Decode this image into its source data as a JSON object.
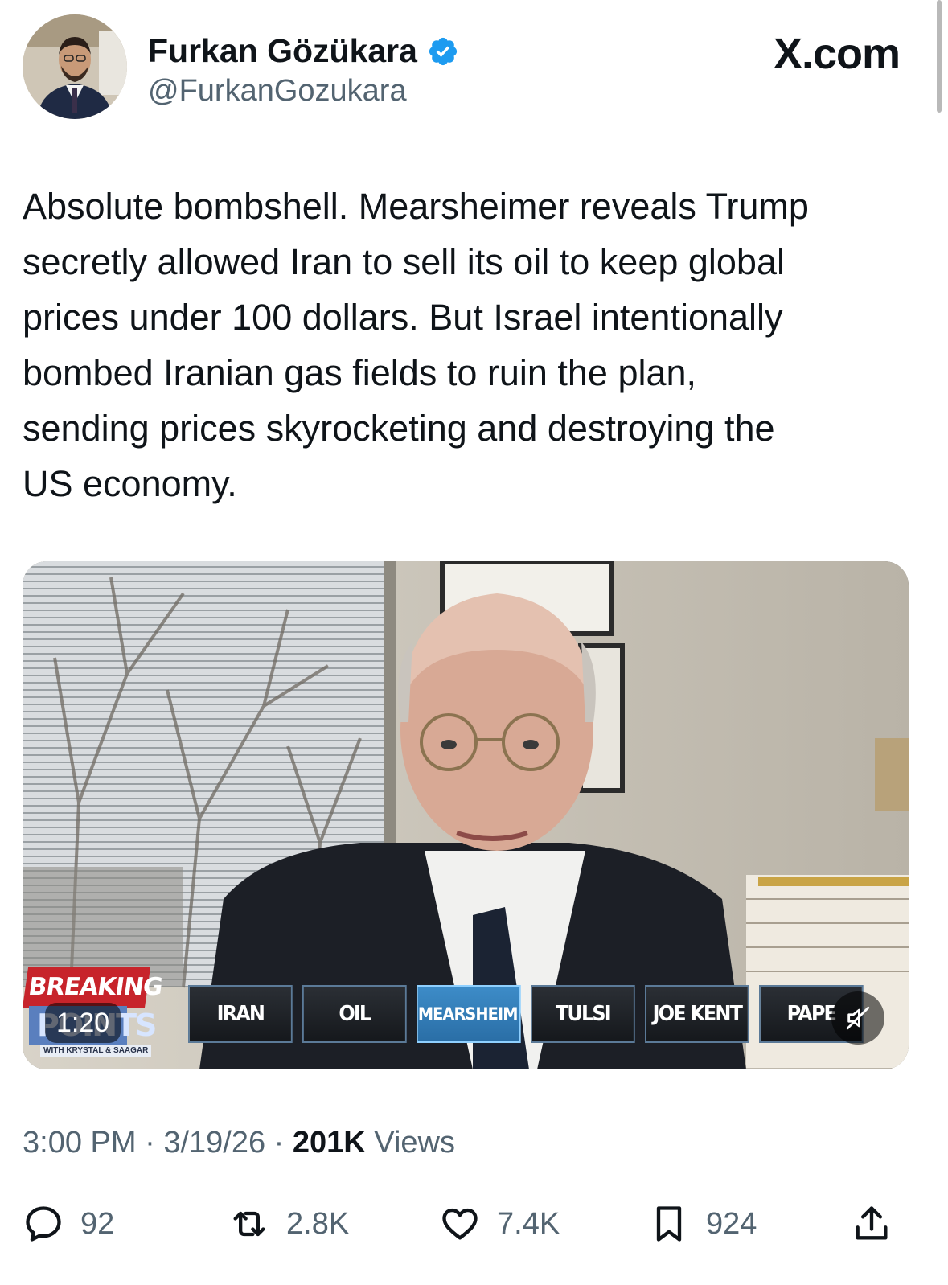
{
  "author": {
    "name": "Furkan Gözükara",
    "handle": "@FurkanGozukara",
    "verified": true,
    "avatar_icon": "profile-photo"
  },
  "site_logo": "X.com",
  "tweet": {
    "text": "Absolute bombshell. Mearsheimer reveals Trump\nsecretly allowed Iran to sell its oil to keep global\nprices under 100 dollars. But Israel intentionally\nbombed Iranian gas fields to ruin the plan,\nsending prices skyrocketing and destroying the\nUS economy."
  },
  "video": {
    "duration": "1:20",
    "breaking_label": "BREAKING",
    "show_logo": "POINTS",
    "show_subtitle": "WITH KRYSTAL & SAAGAR",
    "tags": [
      {
        "label": "IRAN",
        "active": false
      },
      {
        "label": "OIL",
        "active": false
      },
      {
        "label": "MEARSHEIMER",
        "active": true
      },
      {
        "label": "TULSI",
        "active": false
      },
      {
        "label": "JOE KENT",
        "active": false
      },
      {
        "label": "PAPE",
        "active": false
      }
    ],
    "muted_icon": "speaker-muted-icon"
  },
  "meta": {
    "time": "3:00 PM",
    "date": "3/19/26",
    "views_count": "201K",
    "views_label": "Views",
    "separator": "·"
  },
  "actions": {
    "replies": "92",
    "reposts": "2.8K",
    "likes": "7.4K",
    "bookmarks": "924"
  },
  "colors": {
    "text": "#0f1419",
    "secondary": "#536471",
    "verified_blue": "#1d9bf0",
    "breaking_red": "#c7242b"
  }
}
